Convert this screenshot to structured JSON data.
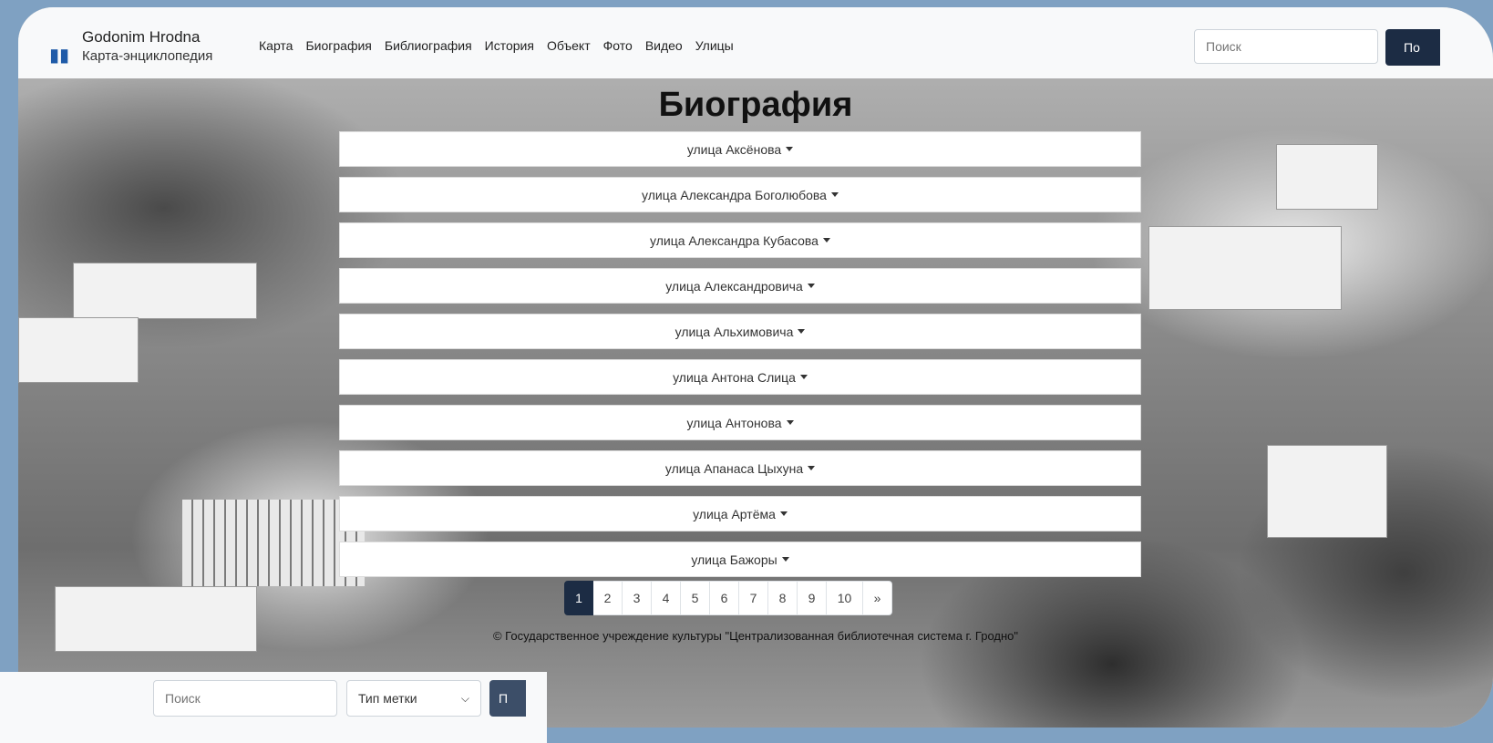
{
  "navbar": {
    "brand_title": "Godonim Hrodna",
    "brand_subtitle": "Карта-энциклопедия",
    "links": [
      "Карта",
      "Биография",
      "Библиография",
      "История",
      "Объект",
      "Фото",
      "Видео",
      "Улицы"
    ],
    "search_placeholder": "Поиск",
    "search_button": "По"
  },
  "page": {
    "title": "Биография"
  },
  "streets": [
    "улица Аксёнова",
    "улица Александра Боголюбова",
    "улица Александра Кубасова",
    "улица Александровича",
    "улица Альхимовича",
    "улица Антона Слица",
    "улица Антонова",
    "улица Апанаса Цыхуна",
    "улица Артёма",
    "улица Бажоры"
  ],
  "pagination": {
    "pages": [
      "1",
      "2",
      "3",
      "4",
      "5",
      "6",
      "7",
      "8",
      "9",
      "10",
      "»"
    ],
    "active": "1"
  },
  "footer": {
    "text": "© Государственное учреждение культуры \"Централизованная библиотечная система г. Гродно\""
  },
  "bottom_bar": {
    "search_placeholder": "Поиск",
    "type_select": "Тип метки",
    "button_label": "П"
  },
  "colors": {
    "accent": "#1c2c44",
    "background": "#7fa1c2"
  }
}
